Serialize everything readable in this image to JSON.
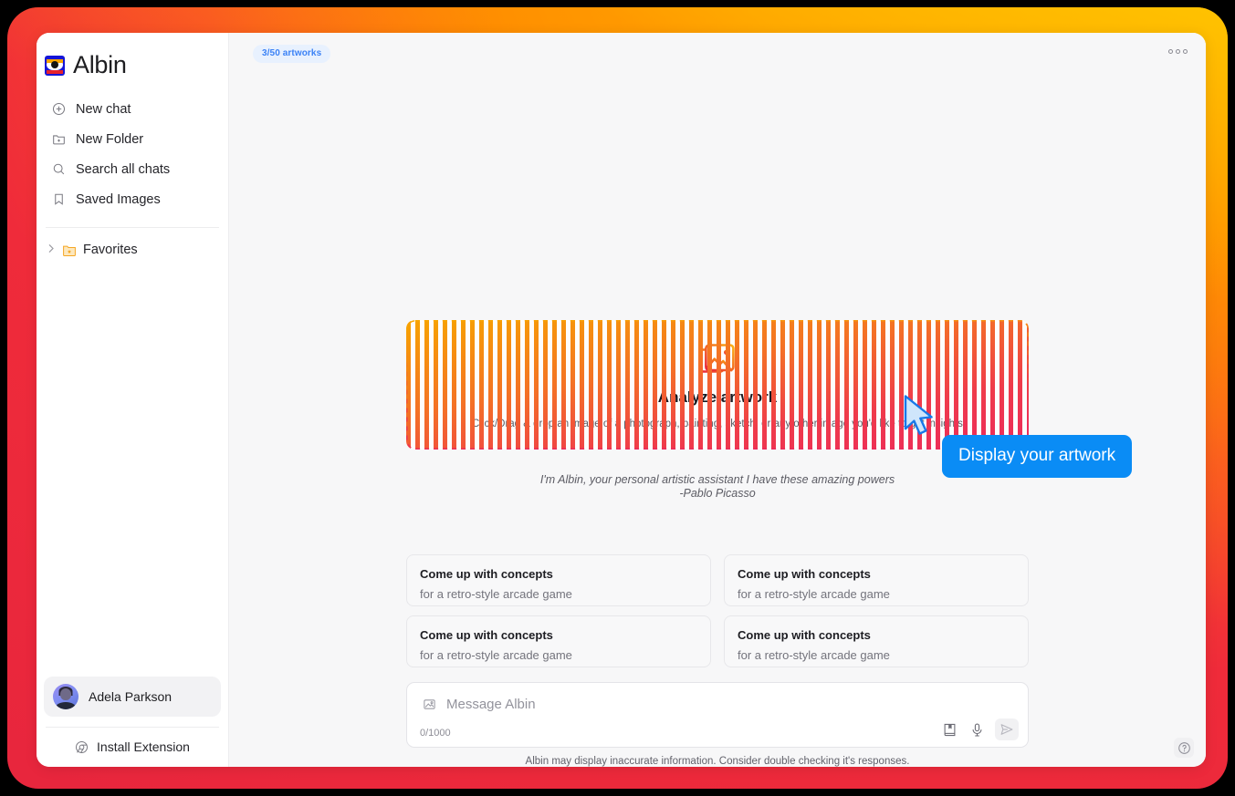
{
  "app": {
    "brand_name": "Albin",
    "logo_icon": "albin-eye-logo"
  },
  "sidebar": {
    "items": [
      {
        "label": "New chat",
        "icon": "plus-circle-icon"
      },
      {
        "label": "New Folder",
        "icon": "folder-plus-icon"
      },
      {
        "label": "Search all chats",
        "icon": "search-icon"
      },
      {
        "label": "Saved Images",
        "icon": "bookmark-icon"
      }
    ],
    "folders": [
      {
        "label": "Favorites",
        "icon": "folder-star-icon",
        "expand_icon": "chevron-right-icon"
      }
    ],
    "profile": {
      "name": "Adela Parkson",
      "avatar_icon": "user-avatar"
    },
    "install": {
      "label": "Install Extension",
      "icon": "chrome-icon"
    }
  },
  "topbar": {
    "artworks_badge": {
      "text": "3/50 artworks",
      "used": 3,
      "total": 50,
      "progress_percent": 6
    },
    "menu_icon": "more-options-icon"
  },
  "dropzone": {
    "icon": "images-stack-icon",
    "title": "Analyze artwork",
    "subtitle": "Click/Drag & drop an image of a photograph, painting, sketch, or any other image you'd like to get insights"
  },
  "tagline": {
    "line1": "I'm Albin, your personal artistic assistant I have these amazing powers",
    "line2": "-Pablo Picasso"
  },
  "suggestions": [
    {
      "title": "Come up with concepts",
      "subtitle": "for a retro-style arcade game"
    },
    {
      "title": "Come up with concepts",
      "subtitle": "for a retro-style arcade game"
    },
    {
      "title": "Come up with concepts",
      "subtitle": "for a retro-style arcade game"
    },
    {
      "title": "Come up with concepts",
      "subtitle": "for a retro-style arcade game"
    }
  ],
  "composer": {
    "attach_icon": "image-icon",
    "placeholder": "Message Albin",
    "char_count": "0/1000",
    "bookmark_icon": "book-icon",
    "mic_icon": "microphone-icon",
    "send_icon": "send-icon",
    "disclaimer": "Albin may display inaccurate information. Consider double checking it's responses."
  },
  "overlay": {
    "tooltip_text": "Display your artwork",
    "cursor_icon": "mouse-pointer-icon"
  },
  "help": {
    "icon": "help-circle-icon"
  },
  "colors": {
    "accent_blue": "#0a8cf5",
    "badge_blue": "#3b82f6",
    "frame_yellow": "#ffc400",
    "frame_red": "#e8263d",
    "main_bg": "#f7f7f8"
  }
}
